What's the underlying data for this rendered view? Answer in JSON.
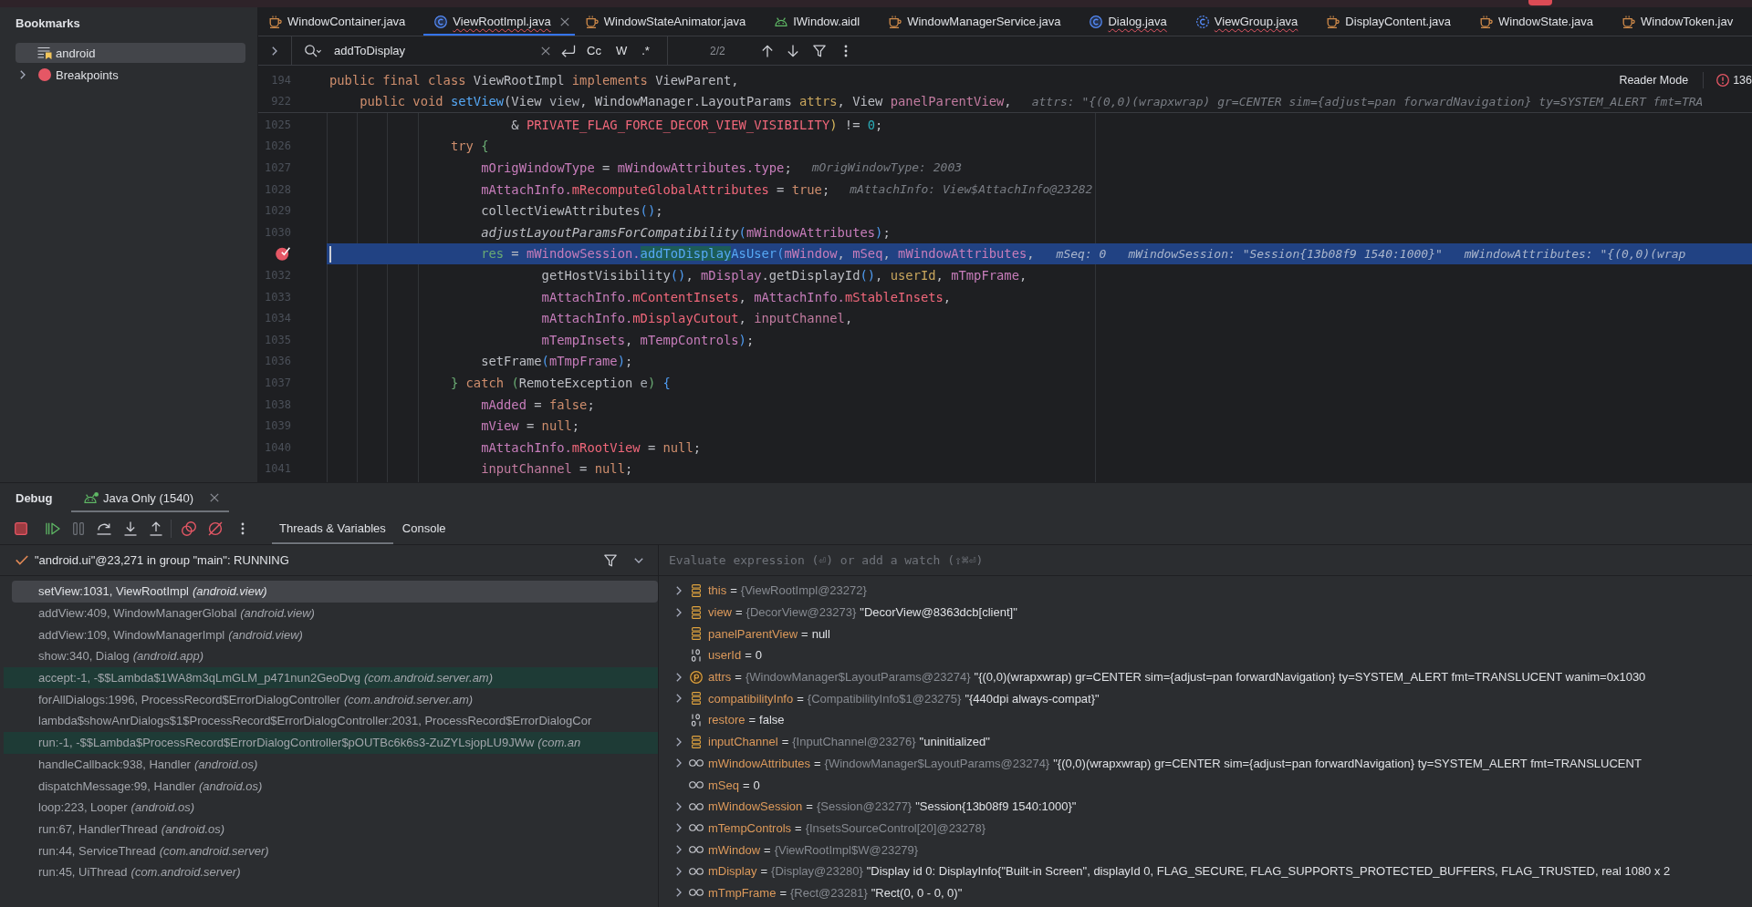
{
  "bookmarks": {
    "title": "Bookmarks",
    "items": [
      {
        "label": "android",
        "kind": "bookmark-list",
        "selected": true,
        "expandable": false
      },
      {
        "label": "Breakpoints",
        "kind": "breakpoint-group",
        "selected": false,
        "expandable": true
      }
    ]
  },
  "editor": {
    "tabs": [
      {
        "label": "WindowContainer.java",
        "kind": "java-file",
        "selected": false,
        "error": false
      },
      {
        "label": "ViewRootImpl.java",
        "kind": "class",
        "selected": true,
        "error": true
      },
      {
        "label": "WindowStateAnimator.java",
        "kind": "java-file",
        "selected": false,
        "error": false
      },
      {
        "label": "IWindow.aidl",
        "kind": "aidl",
        "selected": false,
        "error": false
      },
      {
        "label": "WindowManagerService.java",
        "kind": "java-file",
        "selected": false,
        "error": false
      },
      {
        "label": "Dialog.java",
        "kind": "class",
        "selected": false,
        "error": true
      },
      {
        "label": "ViewGroup.java",
        "kind": "abstract-class",
        "selected": false,
        "error": true
      },
      {
        "label": "DisplayContent.java",
        "kind": "java-file",
        "selected": false,
        "error": false
      },
      {
        "label": "WindowState.java",
        "kind": "java-file",
        "selected": false,
        "error": false
      },
      {
        "label": "WindowToken.jav",
        "kind": "java-file",
        "selected": false,
        "error": false
      }
    ],
    "find": {
      "query": "addToDisplay",
      "options": [
        "Cc",
        "W",
        ".*"
      ],
      "match_count": "2/2"
    },
    "reader_mode": "Reader Mode",
    "problem_count": "136",
    "sticky_lines": [
      {
        "number": "194",
        "tokens": [
          {
            "kind": "kw",
            "text": "public final class "
          },
          {
            "kind": "plain",
            "text": "ViewRootImpl "
          },
          {
            "kind": "kw",
            "text": "implements "
          },
          {
            "kind": "plain",
            "text": "ViewParent,"
          }
        ]
      },
      {
        "number": "922",
        "tokens": [
          {
            "kind": "kw",
            "text": "    public void "
          },
          {
            "kind": "method",
            "text": "setView"
          },
          {
            "kind": "plain",
            "text": "(View "
          },
          {
            "kind": "param",
            "text": "view"
          },
          {
            "kind": "plain",
            "text": ", WindowManager.LayoutParams "
          },
          {
            "kind": "param2",
            "text": "attrs"
          },
          {
            "kind": "plain",
            "text": ", View "
          },
          {
            "kind": "param3",
            "text": "panelParentView"
          },
          {
            "kind": "plain",
            "text": ","
          }
        ],
        "hints": [
          "attrs: \"{(0,0)(wrapxwrap) gr=CENTER sim={adjust=pan forwardNavigation} ty=SYSTEM_ALERT fmt=TRA"
        ]
      }
    ],
    "lines": [
      {
        "number": "1025",
        "breakpoint": false,
        "current": false,
        "tokens": [
          {
            "kind": "plain",
            "text": "                        & "
          },
          {
            "kind": "xfield",
            "text": "PRIVATE_FLAG_FORCE_DECOR_VIEW_VISIBILITY"
          },
          {
            "kind": "bry",
            "text": ")"
          },
          {
            "kind": "plain",
            "text": " != "
          },
          {
            "kind": "num",
            "text": "0"
          },
          {
            "kind": "plain",
            "text": ";"
          }
        ]
      },
      {
        "number": "1026",
        "breakpoint": false,
        "current": false,
        "tokens": [
          {
            "kind": "kw",
            "text": "                try "
          },
          {
            "kind": "brg",
            "text": "{"
          }
        ]
      },
      {
        "number": "1027",
        "breakpoint": false,
        "current": false,
        "tokens": [
          {
            "kind": "field",
            "text": "                    mOrigWindowType"
          },
          {
            "kind": "plain",
            "text": " = "
          },
          {
            "kind": "field",
            "text": "mWindowAttributes.type"
          },
          {
            "kind": "plain",
            "text": ";"
          }
        ],
        "hints": [
          "mOrigWindowType: 2003"
        ]
      },
      {
        "number": "1028",
        "breakpoint": false,
        "current": false,
        "tokens": [
          {
            "kind": "field",
            "text": "                    mAttachInfo."
          },
          {
            "kind": "xfield",
            "text": "mRecomputeGlobalAttributes"
          },
          {
            "kind": "plain",
            "text": " = "
          },
          {
            "kind": "kw",
            "text": "true"
          },
          {
            "kind": "plain",
            "text": ";"
          }
        ],
        "hints": [
          "mAttachInfo: View$AttachInfo@23282"
        ]
      },
      {
        "number": "1029",
        "breakpoint": false,
        "current": false,
        "tokens": [
          {
            "kind": "plain",
            "text": "                    collectViewAttributes"
          },
          {
            "kind": "brb",
            "text": "()"
          },
          {
            "kind": "plain",
            "text": ";"
          }
        ]
      },
      {
        "number": "1030",
        "breakpoint": false,
        "current": false,
        "tokens": [
          {
            "kind": "static",
            "text": "                    adjustLayoutParamsForCompatibility"
          },
          {
            "kind": "brb",
            "text": "("
          },
          {
            "kind": "field",
            "text": "mWindowAttributes"
          },
          {
            "kind": "brb",
            "text": ")"
          },
          {
            "kind": "plain",
            "text": ";"
          }
        ]
      },
      {
        "breakpoint": true,
        "current": true,
        "tokens": [
          {
            "kind": "local",
            "text": "                    res"
          },
          {
            "kind": "plain",
            "text": " = "
          },
          {
            "kind": "field",
            "text": "mWindowSession."
          },
          {
            "kind": "match",
            "text": "addToDisplay"
          },
          {
            "kind": "method",
            "text": "AsUser"
          },
          {
            "kind": "brb",
            "text": "("
          },
          {
            "kind": "field",
            "text": "mWindow"
          },
          {
            "kind": "plain",
            "text": ", "
          },
          {
            "kind": "field",
            "text": "mSeq"
          },
          {
            "kind": "plain",
            "text": ", "
          },
          {
            "kind": "field",
            "text": "mWindowAttributes"
          },
          {
            "kind": "plain",
            "text": ","
          }
        ],
        "hints": [
          "mSeq: 0",
          "mWindowSession: \"Session{13b08f9 1540:1000}\"",
          "mWindowAttributes: \"{(0,0)(wrap"
        ]
      },
      {
        "number": "1032",
        "breakpoint": false,
        "current": false,
        "tokens": [
          {
            "kind": "plain",
            "text": "                            getHostVisibility"
          },
          {
            "kind": "brb",
            "text": "()"
          },
          {
            "kind": "plain",
            "text": ", "
          },
          {
            "kind": "field",
            "text": "mDisplay"
          },
          {
            "kind": "plain",
            "text": ".getDisplayId"
          },
          {
            "kind": "brb",
            "text": "()"
          },
          {
            "kind": "plain",
            "text": ", "
          },
          {
            "kind": "param2",
            "text": "userId"
          },
          {
            "kind": "plain",
            "text": ", "
          },
          {
            "kind": "field",
            "text": "mTmpFrame"
          },
          {
            "kind": "plain",
            "text": ","
          }
        ]
      },
      {
        "number": "1033",
        "breakpoint": false,
        "current": false,
        "tokens": [
          {
            "kind": "field",
            "text": "                            mAttachInfo."
          },
          {
            "kind": "xfield",
            "text": "mContentInsets"
          },
          {
            "kind": "plain",
            "text": ", "
          },
          {
            "kind": "field",
            "text": "mAttachInfo."
          },
          {
            "kind": "xfield",
            "text": "mStableInsets"
          },
          {
            "kind": "plain",
            "text": ","
          }
        ]
      },
      {
        "number": "1034",
        "breakpoint": false,
        "current": false,
        "tokens": [
          {
            "kind": "field",
            "text": "                            mAttachInfo."
          },
          {
            "kind": "xfield",
            "text": "mDisplayCutout"
          },
          {
            "kind": "plain",
            "text": ", "
          },
          {
            "kind": "param3",
            "text": "inputChannel"
          },
          {
            "kind": "plain",
            "text": ","
          }
        ]
      },
      {
        "number": "1035",
        "breakpoint": false,
        "current": false,
        "tokens": [
          {
            "kind": "field",
            "text": "                            mTempInsets"
          },
          {
            "kind": "plain",
            "text": ", "
          },
          {
            "kind": "field",
            "text": "mTempControls"
          },
          {
            "kind": "brb",
            "text": ")"
          },
          {
            "kind": "plain",
            "text": ";"
          }
        ]
      },
      {
        "number": "1036",
        "breakpoint": false,
        "current": false,
        "tokens": [
          {
            "kind": "plain",
            "text": "                    setFrame"
          },
          {
            "kind": "brb",
            "text": "("
          },
          {
            "kind": "field",
            "text": "mTmpFrame"
          },
          {
            "kind": "brb",
            "text": ")"
          },
          {
            "kind": "plain",
            "text": ";"
          }
        ]
      },
      {
        "number": "1037",
        "breakpoint": false,
        "current": false,
        "tokens": [
          {
            "kind": "brg",
            "text": "                }"
          },
          {
            "kind": "kw",
            "text": " catch "
          },
          {
            "kind": "brg",
            "text": "("
          },
          {
            "kind": "plain",
            "text": "RemoteException "
          },
          {
            "kind": "param",
            "text": "e"
          },
          {
            "kind": "brg",
            "text": ")"
          },
          {
            "kind": "brb",
            "text": " {"
          }
        ]
      },
      {
        "number": "1038",
        "breakpoint": false,
        "current": false,
        "tokens": [
          {
            "kind": "field",
            "text": "                    mAdded"
          },
          {
            "kind": "plain",
            "text": " = "
          },
          {
            "kind": "kw",
            "text": "false"
          },
          {
            "kind": "plain",
            "text": ";"
          }
        ]
      },
      {
        "number": "1039",
        "breakpoint": false,
        "current": false,
        "tokens": [
          {
            "kind": "field",
            "text": "                    mView"
          },
          {
            "kind": "plain",
            "text": " = "
          },
          {
            "kind": "kw",
            "text": "null"
          },
          {
            "kind": "plain",
            "text": ";"
          }
        ]
      },
      {
        "number": "1040",
        "breakpoint": false,
        "current": false,
        "tokens": [
          {
            "kind": "field",
            "text": "                    mAttachInfo."
          },
          {
            "kind": "xfield",
            "text": "mRootView"
          },
          {
            "kind": "plain",
            "text": " = "
          },
          {
            "kind": "kw",
            "text": "null"
          },
          {
            "kind": "plain",
            "text": ";"
          }
        ]
      },
      {
        "number": "1041",
        "breakpoint": false,
        "current": false,
        "tokens": [
          {
            "kind": "param3",
            "text": "                    inputChannel"
          },
          {
            "kind": "plain",
            "text": " = "
          },
          {
            "kind": "kw",
            "text": "null"
          },
          {
            "kind": "plain",
            "text": ";"
          }
        ]
      }
    ]
  },
  "debug": {
    "title": "Debug",
    "sessions": [
      {
        "label": "Java Only (1540)",
        "selected": true
      }
    ],
    "tabs": [
      {
        "label": "Threads & Variables",
        "selected": true
      },
      {
        "label": "Console",
        "selected": false
      }
    ],
    "thread": "\"android.ui\"@23,271 in group \"main\": RUNNING",
    "frames": [
      {
        "method": "setView:1031, ViewRootImpl",
        "package": "(android.view)",
        "selected": true,
        "highlighted": false
      },
      {
        "method": "addView:409, WindowManagerGlobal",
        "package": "(android.view)",
        "selected": false,
        "highlighted": false
      },
      {
        "method": "addView:109, WindowManagerImpl",
        "package": "(android.view)",
        "selected": false,
        "highlighted": false
      },
      {
        "method": "show:340, Dialog",
        "package": "(android.app)",
        "selected": false,
        "highlighted": false
      },
      {
        "method": "accept:-1, -$$Lambda$1WA8m3qLmGLM_p471nun2GeoDvg",
        "package": "(com.android.server.am)",
        "selected": false,
        "highlighted": true
      },
      {
        "method": "forAllDialogs:1996, ProcessRecord$ErrorDialogController",
        "package": "(com.android.server.am)",
        "selected": false,
        "highlighted": false
      },
      {
        "method": "lambda$showAnrDialogs$1$ProcessRecord$ErrorDialogController:2031, ProcessRecord$ErrorDialogCor",
        "selected": false,
        "highlighted": false
      },
      {
        "method": "run:-1, -$$Lambda$ProcessRecord$ErrorDialogController$pOUTBc6k6s3-ZuZYLsjopLU9JWw",
        "package": "(com.an",
        "selected": false,
        "highlighted": true
      },
      {
        "method": "handleCallback:938, Handler",
        "package": "(android.os)",
        "selected": false,
        "highlighted": false
      },
      {
        "method": "dispatchMessage:99, Handler",
        "package": "(android.os)",
        "selected": false,
        "highlighted": false
      },
      {
        "method": "loop:223, Looper",
        "package": "(android.os)",
        "selected": false,
        "highlighted": false
      },
      {
        "method": "run:67, HandlerThread",
        "package": "(android.os)",
        "selected": false,
        "highlighted": false
      },
      {
        "method": "run:44, ServiceThread",
        "package": "(com.android.server)",
        "selected": false,
        "highlighted": false
      },
      {
        "method": "run:45, UiThread",
        "package": "(com.android.server)",
        "selected": false,
        "highlighted": false
      }
    ],
    "evaluate": {
      "placeholder": "Evaluate expression (⏎) or add a watch (⇧⌘⏎)"
    },
    "variables": [
      {
        "name": "this",
        "sep": "=",
        "type": "{ViewRootImpl@23272}",
        "kind": "object",
        "expandable": true
      },
      {
        "name": "view",
        "sep": "=",
        "type": "{DecorView@23273}",
        "value": "\"DecorView@8363dcb[client]\"",
        "kind": "object",
        "expandable": true
      },
      {
        "name": "panelParentView",
        "sep": "=",
        "value": "null",
        "kind": "object",
        "expandable": false
      },
      {
        "name": "userId",
        "sep": "=",
        "value": "0",
        "kind": "primitive",
        "expandable": false
      },
      {
        "name": "attrs",
        "sep": "=",
        "type": "{WindowManager$LayoutParams@23274}",
        "value": "\"{(0,0)(wrapxwrap) gr=CENTER sim={adjust=pan forwardNavigation} ty=SYSTEM_ALERT fmt=TRANSLUCENT wanim=0x1030",
        "kind": "parameter",
        "expandable": true
      },
      {
        "name": "compatibilityInfo",
        "sep": "=",
        "type": "{CompatibilityInfo$1@23275}",
        "value": "\"{440dpi always-compat}\"",
        "kind": "object",
        "expandable": true
      },
      {
        "name": "restore",
        "sep": "=",
        "value": "false",
        "kind": "primitive",
        "expandable": false
      },
      {
        "name": "inputChannel",
        "sep": "=",
        "type": "{InputChannel@23276}",
        "value": "\"uninitialized\"",
        "kind": "object",
        "expandable": true
      },
      {
        "name": "mWindowAttributes",
        "sep": "=",
        "type": "{WindowManager$LayoutParams@23274}",
        "value": "\"{(0,0)(wrapxwrap) gr=CENTER sim={adjust=pan forwardNavigation} ty=SYSTEM_ALERT fmt=TRANSLUCENT",
        "kind": "field",
        "expandable": true
      },
      {
        "name": "mSeq",
        "sep": "=",
        "value": "0",
        "kind": "field",
        "expandable": false
      },
      {
        "name": "mWindowSession",
        "sep": "=",
        "type": "{Session@23277}",
        "value": "\"Session{13b08f9 1540:1000}\"",
        "kind": "field",
        "expandable": true
      },
      {
        "name": "mTempControls",
        "sep": "=",
        "type": "{InsetsSourceControl[20]@23278}",
        "kind": "field",
        "expandable": true
      },
      {
        "name": "mWindow",
        "sep": "=",
        "type": "{ViewRootImpl$W@23279}",
        "kind": "field",
        "expandable": true
      },
      {
        "name": "mDisplay",
        "sep": "=",
        "type": "{Display@23280}",
        "value": "\"Display id 0: DisplayInfo{\"Built-in Screen\", displayId 0, FLAG_SECURE, FLAG_SUPPORTS_PROTECTED_BUFFERS, FLAG_TRUSTED, real 1080 x 2",
        "kind": "field",
        "expandable": true
      },
      {
        "name": "mTmpFrame",
        "sep": "=",
        "type": "{Rect@23281}",
        "value": "\"Rect(0, 0 - 0, 0)\"",
        "kind": "field",
        "expandable": true
      }
    ]
  }
}
